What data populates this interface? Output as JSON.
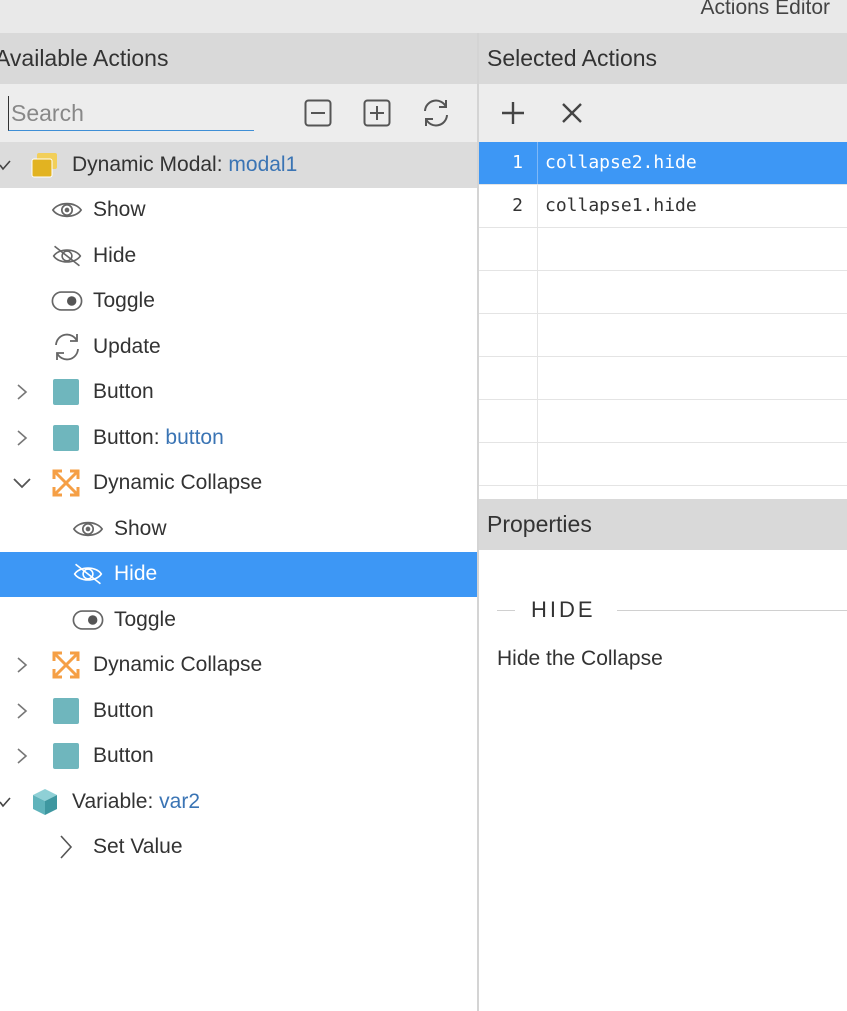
{
  "window": {
    "title": "Actions Editor"
  },
  "left_panel": {
    "header": "Available Actions",
    "search_placeholder": "Search",
    "tree": [
      {
        "kind": "group",
        "label": "Dynamic Modal: ",
        "highlight": "modal1",
        "icon": "modal-icon",
        "chevron": "check"
      },
      {
        "kind": "action",
        "label": "Show",
        "icon": "eye-icon"
      },
      {
        "kind": "action",
        "label": "Hide",
        "icon": "eye-slash-icon"
      },
      {
        "kind": "action",
        "label": "Toggle",
        "icon": "toggle-icon"
      },
      {
        "kind": "action",
        "label": "Update",
        "icon": "refresh-icon"
      },
      {
        "kind": "collapsed",
        "label": "Button",
        "icon": "button-icon"
      },
      {
        "kind": "collapsed",
        "label": "Button: ",
        "highlight": "button",
        "icon": "button-icon"
      },
      {
        "kind": "expanded",
        "label": "Dynamic Collapse",
        "icon": "collapse-icon"
      },
      {
        "kind": "subaction",
        "label": "Show",
        "icon": "eye-icon"
      },
      {
        "kind": "subaction-selected",
        "label": "Hide",
        "icon": "eye-slash-icon"
      },
      {
        "kind": "subaction",
        "label": "Toggle",
        "icon": "toggle-icon"
      },
      {
        "kind": "collapsed",
        "label": "Dynamic Collapse",
        "icon": "collapse-icon"
      },
      {
        "kind": "collapsed",
        "label": "Button",
        "icon": "button-icon"
      },
      {
        "kind": "collapsed",
        "label": "Button",
        "icon": "button-icon"
      },
      {
        "kind": "group2",
        "label": "Variable: ",
        "highlight": "var2",
        "icon": "cube-icon",
        "chevron": "check"
      },
      {
        "kind": "setvalue",
        "label": "Set Value",
        "icon": "chevron-right-icon"
      }
    ]
  },
  "right_panel": {
    "header": "Selected Actions",
    "selected_actions": [
      {
        "index": "1",
        "name": "collapse2.hide",
        "selected": true
      },
      {
        "index": "2",
        "name": "collapse1.hide",
        "selected": false
      }
    ],
    "properties": {
      "header": "Properties",
      "title": "HIDE",
      "description": "Hide the Collapse"
    }
  },
  "colors": {
    "selection": "#3d97f5",
    "link": "#3a74b4",
    "modal_icon": "#e8b82a",
    "button_icon": "#6fb6bd",
    "collapse_icon": "#f59f45"
  }
}
